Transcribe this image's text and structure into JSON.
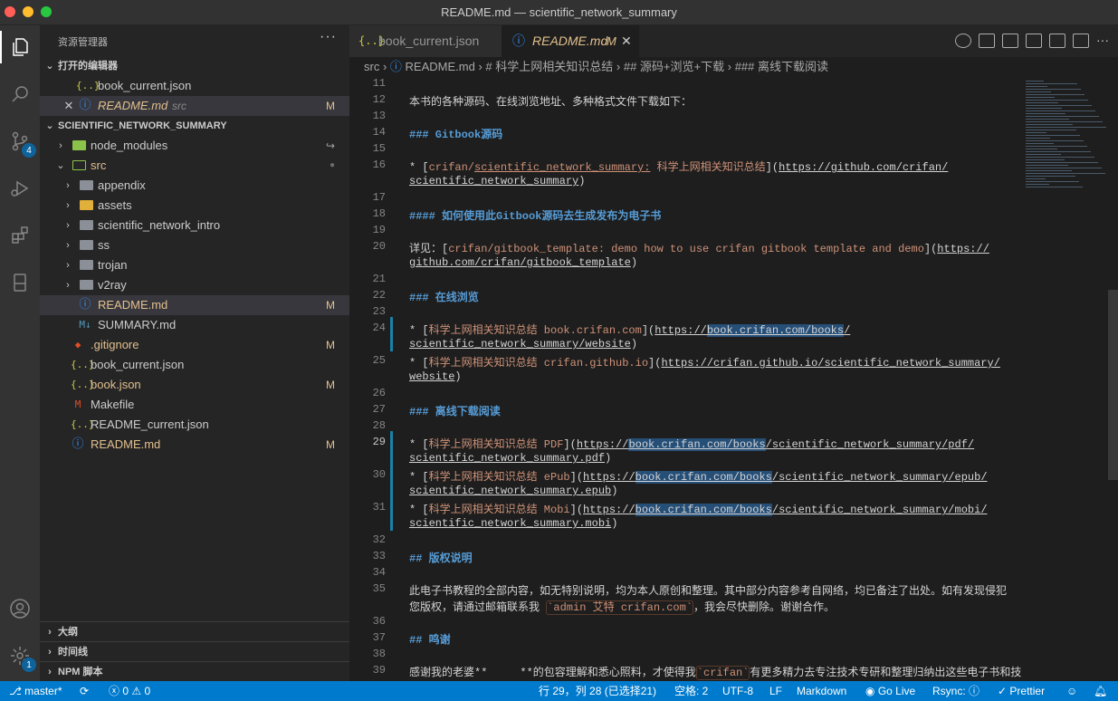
{
  "window": {
    "title": "README.md — scientific_network_summary"
  },
  "activity_bar": {
    "scm_badge": "4",
    "settings_badge": "1"
  },
  "sidebar": {
    "title": "资源管理器",
    "open_editors": {
      "header": "打开的编辑器",
      "items": [
        {
          "name": "book_current.json",
          "desc": "",
          "modified": ""
        },
        {
          "name": "README.md",
          "desc": "src",
          "modified": "M"
        }
      ]
    },
    "project": {
      "header": "SCIENTIFIC_NETWORK_SUMMARY",
      "items": [
        {
          "name": "node_modules",
          "mark": "↪"
        },
        {
          "name": "src",
          "mark": "●"
        },
        {
          "name": "appendix",
          "mark": ""
        },
        {
          "name": "assets",
          "mark": ""
        },
        {
          "name": "scientific_network_intro",
          "mark": ""
        },
        {
          "name": "ss",
          "mark": ""
        },
        {
          "name": "trojan",
          "mark": ""
        },
        {
          "name": "v2ray",
          "mark": ""
        },
        {
          "name": "README.md",
          "mark": "M"
        },
        {
          "name": "SUMMARY.md",
          "mark": ""
        },
        {
          "name": ".gitignore",
          "mark": "M"
        },
        {
          "name": "book_current.json",
          "mark": ""
        },
        {
          "name": "book.json",
          "mark": "M"
        },
        {
          "name": "Makefile",
          "mark": ""
        },
        {
          "name": "README_current.json",
          "mark": ""
        },
        {
          "name": "README.md",
          "mark": "M"
        }
      ]
    },
    "panels": [
      "大纲",
      "时间线",
      "NPM 脚本"
    ]
  },
  "tabs": [
    {
      "label": "book_current.json",
      "icon": "{..}",
      "modified": ""
    },
    {
      "label": "README.md",
      "icon": "ⓘ",
      "modified": "M"
    }
  ],
  "breadcrumb": [
    "src",
    "README.md",
    "# 科学上网相关知识总结",
    "## 源码+浏览+下载",
    "### 离线下载阅读"
  ],
  "editor": {
    "lines": [
      {
        "n": "11",
        "t": ""
      },
      {
        "n": "12",
        "t": "本书的各种源码、在线浏览地址、多种格式文件下载如下："
      },
      {
        "n": "13",
        "t": ""
      },
      {
        "n": "14",
        "t": "### Gitbook源码"
      },
      {
        "n": "15",
        "t": ""
      },
      {
        "n": "16",
        "t": "* [crifan/scientific_network_summary: 科学上网相关知识总结](https://github.com/crifan/"
      },
      {
        "n": "",
        "t": "scientific_network_summary)"
      },
      {
        "n": "17",
        "t": ""
      },
      {
        "n": "18",
        "t": "#### 如何使用此Gitbook源码去生成发布为电子书"
      },
      {
        "n": "19",
        "t": ""
      },
      {
        "n": "20",
        "t": "详见：[crifan/gitbook_template: demo how to use crifan gitbook template and demo](https://"
      },
      {
        "n": "",
        "t": "github.com/crifan/gitbook_template)"
      },
      {
        "n": "21",
        "t": ""
      },
      {
        "n": "22",
        "t": "### 在线浏览"
      },
      {
        "n": "23",
        "t": ""
      },
      {
        "n": "24",
        "t": "* [科学上网相关知识总结 book.crifan.com](https://book.crifan.com/books/"
      },
      {
        "n": "",
        "t": "scientific_network_summary/website)"
      },
      {
        "n": "25",
        "t": "* [科学上网相关知识总结 crifan.github.io](https://crifan.github.io/scientific_network_summary/"
      },
      {
        "n": "",
        "t": "website)"
      },
      {
        "n": "26",
        "t": ""
      },
      {
        "n": "27",
        "t": "### 离线下载阅读"
      },
      {
        "n": "28",
        "t": ""
      },
      {
        "n": "29",
        "t": "* [科学上网相关知识总结 PDF](https://book.crifan.com/books/scientific_network_summary/pdf/"
      },
      {
        "n": "",
        "t": "scientific_network_summary.pdf)"
      },
      {
        "n": "30",
        "t": "* [科学上网相关知识总结 ePub](https://book.crifan.com/books/scientific_network_summary/epub/"
      },
      {
        "n": "",
        "t": "scientific_network_summary.epub)"
      },
      {
        "n": "31",
        "t": "* [科学上网相关知识总结 Mobi](https://book.crifan.com/books/scientific_network_summary/mobi/"
      },
      {
        "n": "",
        "t": "scientific_network_summary.mobi)"
      },
      {
        "n": "32",
        "t": ""
      },
      {
        "n": "33",
        "t": "## 版权说明"
      },
      {
        "n": "34",
        "t": ""
      },
      {
        "n": "35",
        "t": "此电子书教程的全部内容，如无特别说明，均为本人原创和整理。其中部分内容参考自网络，均已备注了出处。如有发现侵犯"
      },
      {
        "n": "",
        "t": "您版权，请通过邮箱联系我 `admin 艾特 crifan.com`，我会尽快删除。谢谢合作。"
      },
      {
        "n": "36",
        "t": ""
      },
      {
        "n": "37",
        "t": "## 鸣谢"
      },
      {
        "n": "38",
        "t": ""
      },
      {
        "n": "39",
        "t": "感谢我的老婆**     **的包容理解和悉心照料，才使得我`crifan`有更多精力去专注技术专研和整理归纳出这些电子书和技"
      }
    ]
  },
  "status": {
    "branch": "master*",
    "errors": "0",
    "warnings": "0",
    "position": "行 29，列 28 (已选择21)",
    "indent": "空格: 2",
    "encoding": "UTF-8",
    "eol": "LF",
    "language": "Markdown",
    "golive": "Go Live",
    "rsync": "Rsync: ⓘ",
    "prettier": "Prettier"
  }
}
